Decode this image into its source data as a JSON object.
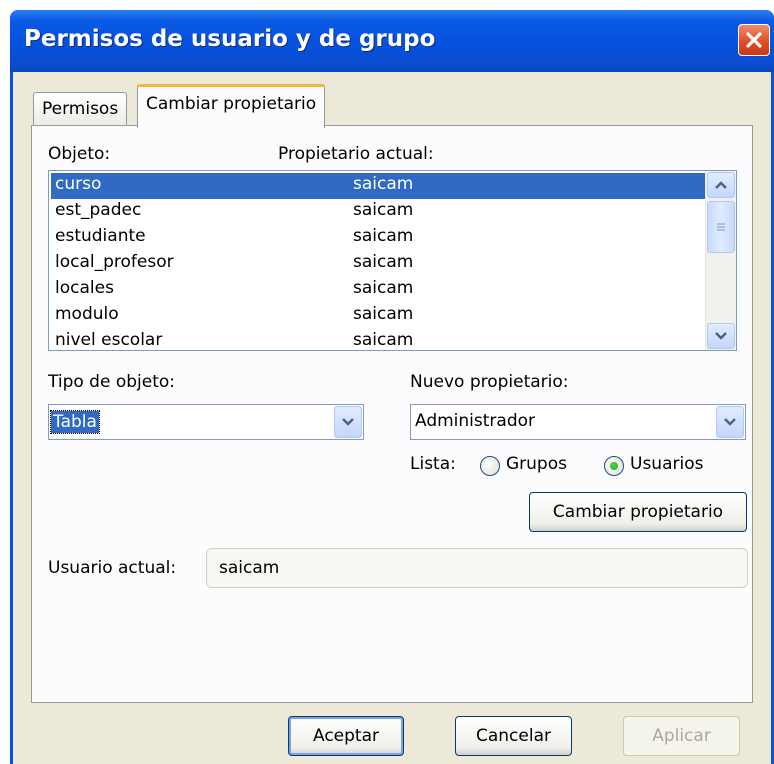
{
  "window": {
    "title": "Permisos de usuario y de grupo",
    "close_icon": "close-x-icon"
  },
  "tabs": [
    {
      "label": "Permisos",
      "active": false
    },
    {
      "label": "Cambiar propietario",
      "active": true
    }
  ],
  "objects": {
    "label_objeto": "Objeto:",
    "label_propietario": "Propietario actual:",
    "rows": [
      {
        "name": "curso",
        "owner": "saicam",
        "selected": true
      },
      {
        "name": "est_padec",
        "owner": "saicam"
      },
      {
        "name": "estudiante",
        "owner": "saicam"
      },
      {
        "name": "local_profesor",
        "owner": "saicam"
      },
      {
        "name": "locales",
        "owner": "saicam"
      },
      {
        "name": "modulo",
        "owner": "saicam"
      },
      {
        "name": "nivel escolar",
        "owner": "saicam"
      }
    ]
  },
  "tipo_objeto": {
    "label": "Tipo de objeto:",
    "value": "Tabla"
  },
  "nuevo_propietario": {
    "label": "Nuevo propietario:",
    "value": "Administrador"
  },
  "lista": {
    "label": "Lista:",
    "options": [
      "Grupos",
      "Usuarios"
    ],
    "selected": "Usuarios"
  },
  "cambiar_button": "Cambiar propietario",
  "usuario_actual": {
    "label": "Usuario actual:",
    "value": "saicam"
  },
  "buttons": {
    "ok": "Aceptar",
    "cancel": "Cancelar",
    "apply": "Aplicar"
  },
  "colors": {
    "titlebar": "#0551de",
    "selection": "#316ac5",
    "dialog_bg": "#ece9d8"
  }
}
